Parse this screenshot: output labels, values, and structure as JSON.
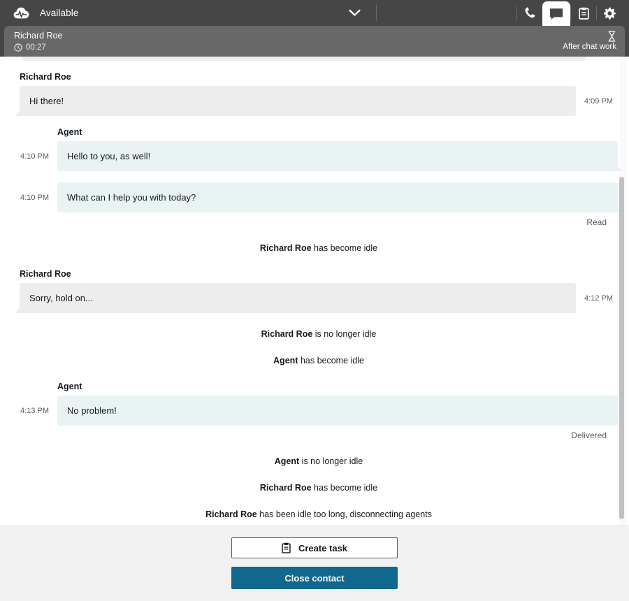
{
  "topbar": {
    "status_label": "Available",
    "logo_icon": "amazon-connect-cloud-icon",
    "chevron_icon": "chevron-down-icon",
    "icons": [
      {
        "name": "phone-icon",
        "label": "Phone",
        "active": false
      },
      {
        "name": "chat-icon",
        "label": "Chat",
        "active": true
      },
      {
        "name": "task-clipboard-icon",
        "label": "Tasks",
        "active": false
      },
      {
        "name": "gear-icon",
        "label": "Settings",
        "active": false
      }
    ]
  },
  "contact": {
    "name": "Richard Roe",
    "timer": "00:27",
    "clock_icon": "clock-icon",
    "state_label": "After chat work",
    "state_icon": "hourglass-icon"
  },
  "transcript": {
    "items": [
      {
        "kind": "message",
        "side": "customer",
        "sender": "Richard Roe",
        "text": "Hi there!",
        "time": "4:09 PM"
      },
      {
        "kind": "message",
        "side": "agent",
        "sender": "Agent",
        "text": "Hello to you, as well!",
        "time": "4:10 PM"
      },
      {
        "kind": "message",
        "side": "agent",
        "sender": null,
        "text": "What can I help you with today?",
        "time": "4:10 PM",
        "receipt": "Read"
      },
      {
        "kind": "system",
        "who": "Richard Roe",
        "what": "has become idle"
      },
      {
        "kind": "message",
        "side": "customer",
        "sender": "Richard Roe",
        "text": "Sorry, hold on...",
        "time": "4:12 PM"
      },
      {
        "kind": "system",
        "who": "Richard Roe",
        "what": "is no longer idle"
      },
      {
        "kind": "system",
        "who": "Agent",
        "what": "has become idle"
      },
      {
        "kind": "message",
        "side": "agent",
        "sender": "Agent",
        "text": "No problem!",
        "time": "4:13 PM",
        "receipt": "Delivered"
      },
      {
        "kind": "system",
        "who": "Agent",
        "what": "is no longer idle"
      },
      {
        "kind": "system",
        "who": "Richard Roe",
        "what": "has become idle"
      },
      {
        "kind": "system",
        "who": "Richard Roe",
        "what": "has been idle too long, disconnecting agents"
      }
    ]
  },
  "footer": {
    "create_task_label": "Create task",
    "create_task_icon": "task-clipboard-icon",
    "close_contact_label": "Close contact"
  },
  "colors": {
    "topbar_bg": "#464646",
    "contact_card_bg": "#686868",
    "customer_bubble": "#ededed",
    "agent_bubble": "#e9f3f4",
    "primary_button": "#10688f",
    "footer_bg": "#f1f1f1"
  }
}
